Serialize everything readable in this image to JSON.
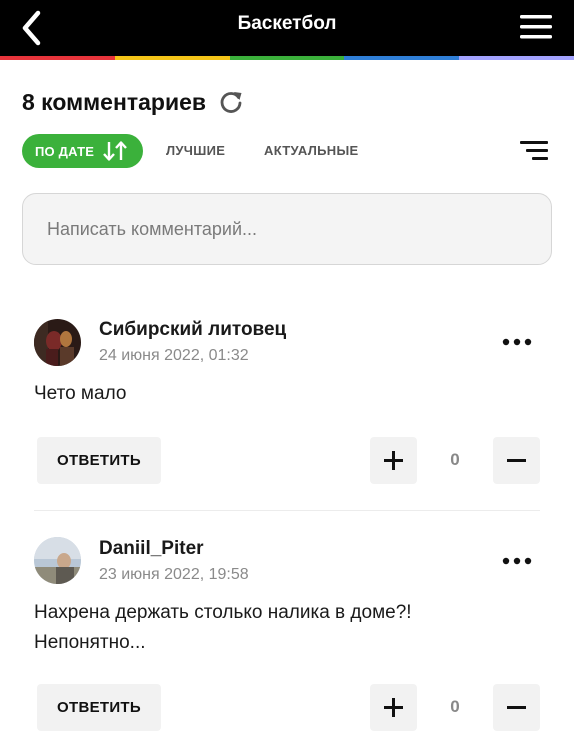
{
  "header": {
    "title": "Баскетбол",
    "back_icon": "chevron-left-icon",
    "menu_icon": "hamburger-menu-icon",
    "stripe_colors": [
      "#e8343b",
      "#f5c518",
      "#3bb13b",
      "#2f7fd8",
      "#a3a3ff"
    ]
  },
  "comments_header": {
    "title": "8 комментариев",
    "refresh_icon": "refresh-icon"
  },
  "sort": {
    "active_label": "ПО ДАТЕ",
    "active_icon": "sort-arrows-icon",
    "options": [
      "ЛУЧШИЕ",
      "АКТУАЛЬНЫЕ"
    ],
    "filter_icon": "filter-lines-icon",
    "accent": "#3bb13b"
  },
  "composer": {
    "placeholder": "Написать комментарий..."
  },
  "comments": [
    {
      "author": "Сибирский литовец",
      "date": "24 июня 2022, 01:32",
      "text": "Чето мало",
      "reply_label": "ОТВЕТИТЬ",
      "votes": "0"
    },
    {
      "author": "Daniil_Piter",
      "date": "23 июня 2022, 19:58",
      "text": "Нахрена держать столько налика в доме?! Непонятно...",
      "reply_label": "ОТВЕТИТЬ",
      "votes": "0"
    }
  ]
}
